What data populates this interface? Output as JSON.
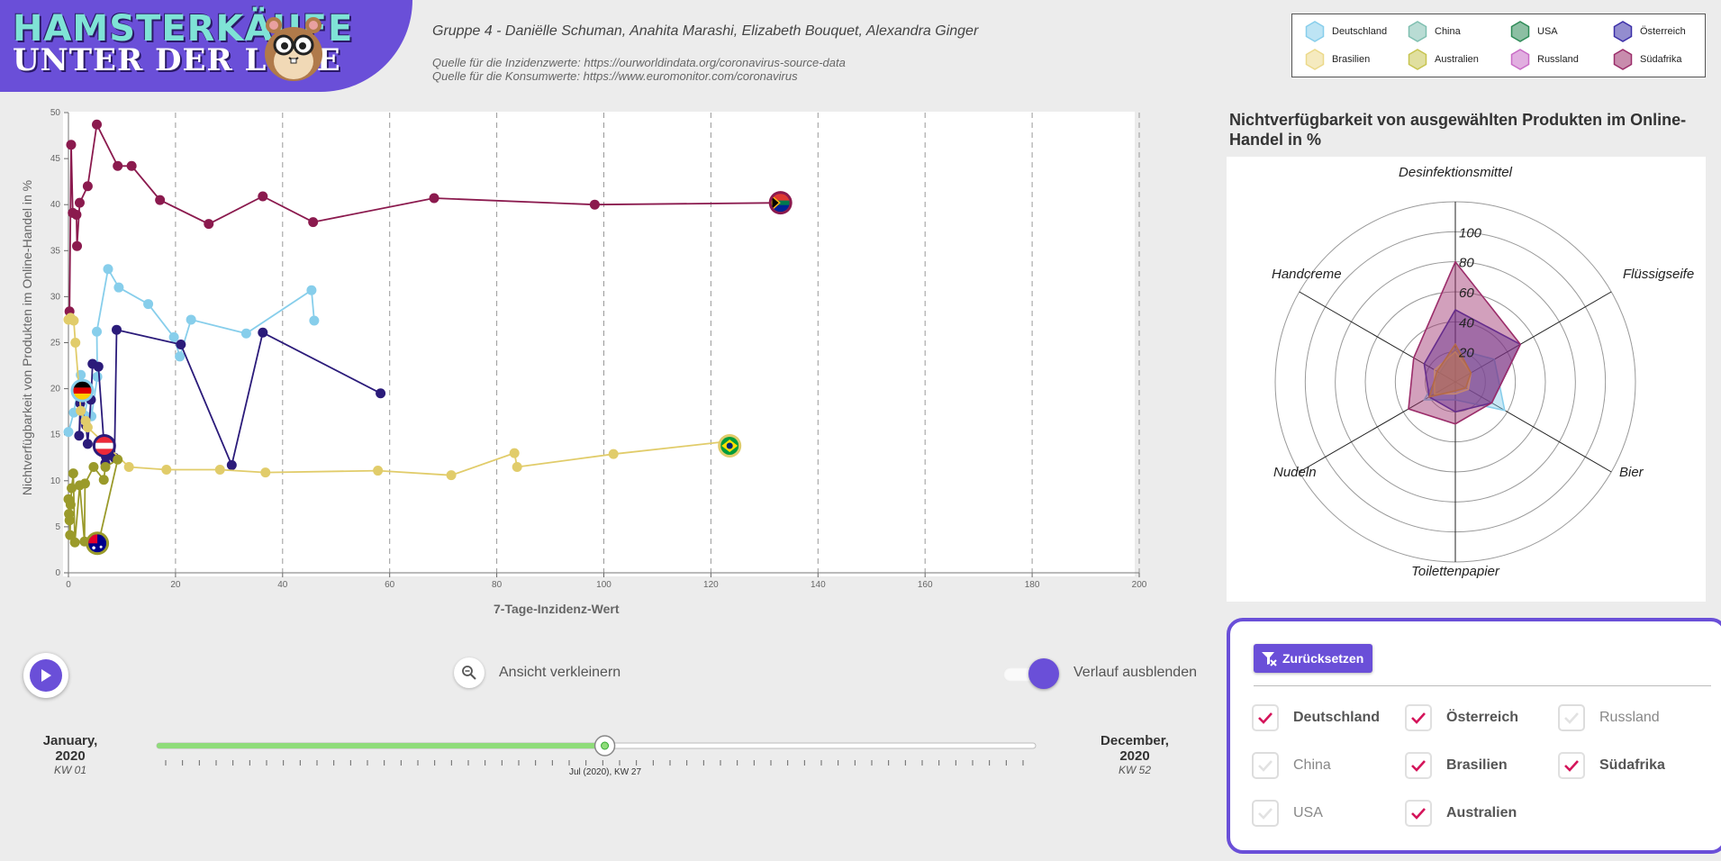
{
  "header": {
    "logo_line1": "HAMSTERKÄUFE",
    "logo_line2": "UNTER DER LUPE",
    "group": "Gruppe 4 - Daniëlle Schuman, Anahita Marashi, Elizabeth Bouquet, Alexandra Ginger",
    "source_incidence": "Quelle für die Inzidenzwerte: https://ourworldindata.org/coronavirus-source-data",
    "source_consumption": "Quelle für die Konsumwerte: https://www.euromonitor.com/coronavirus"
  },
  "legend": [
    {
      "name": "Deutschland",
      "color": "#87ceeb"
    },
    {
      "name": "China",
      "color": "#7fbfb0"
    },
    {
      "name": "USA",
      "color": "#2e8b57"
    },
    {
      "name": "Österreich",
      "color": "#3b2fa8"
    },
    {
      "name": "Brasilien",
      "color": "#ecd98a"
    },
    {
      "name": "Australien",
      "color": "#c7c450"
    },
    {
      "name": "Russland",
      "color": "#c96bc6"
    },
    {
      "name": "Südafrika",
      "color": "#9b2d6a"
    }
  ],
  "chart_data": [
    {
      "type": "scatter",
      "xlabel": "7-Tage-Inzidenz-Wert",
      "ylabel": "Nichtverfügbarkeit von Produkten im Online-Handel in %",
      "xlim": [
        0,
        200
      ],
      "ylim": [
        0,
        50
      ],
      "xticks": [
        0,
        20,
        40,
        60,
        80,
        100,
        120,
        140,
        160,
        180,
        200
      ],
      "yticks": [
        0,
        5,
        10,
        15,
        20,
        25,
        30,
        35,
        40,
        45,
        50
      ],
      "grid_x": "dashed",
      "series": [
        {
          "name": "Südafrika",
          "color": "#8b1a4e",
          "points": [
            [
              0.2,
              28.4
            ],
            [
              0.5,
              46.5
            ],
            [
              0.8,
              39.1
            ],
            [
              1.5,
              38.9
            ],
            [
              1.6,
              35.5
            ],
            [
              2.1,
              40.2
            ],
            [
              3.6,
              42.0
            ],
            [
              5.3,
              48.7
            ],
            [
              9.2,
              44.2
            ],
            [
              11.8,
              44.2
            ],
            [
              17.1,
              40.5
            ],
            [
              26.2,
              37.9
            ],
            [
              36.3,
              40.9
            ],
            [
              45.7,
              38.1
            ],
            [
              68.3,
              40.7
            ],
            [
              98.3,
              40.0
            ],
            [
              133.0,
              40.2
            ]
          ]
        },
        {
          "name": "Deutschland",
          "color": "#87ceeb",
          "points": [
            [
              0.0,
              15.3
            ],
            [
              1.0,
              17.4
            ],
            [
              2.3,
              21.5
            ],
            [
              3.0,
              17.1
            ],
            [
              3.9,
              19.8
            ],
            [
              4.3,
              17.0
            ],
            [
              5.4,
              21.3
            ],
            [
              5.3,
              26.2
            ],
            [
              7.4,
              33.0
            ],
            [
              9.4,
              31.0
            ],
            [
              14.9,
              29.2
            ],
            [
              19.7,
              25.6
            ],
            [
              20.8,
              23.5
            ],
            [
              22.9,
              27.5
            ],
            [
              33.2,
              26.0
            ],
            [
              45.4,
              30.7
            ],
            [
              45.9,
              27.4
            ]
          ]
        },
        {
          "name": "Österreich",
          "color": "#2b1b7a",
          "points": [
            [
              2.6,
              19.8
            ],
            [
              2.0,
              14.9
            ],
            [
              2.2,
              18.4
            ],
            [
              3.3,
              16.0
            ],
            [
              3.6,
              14.0
            ],
            [
              4.2,
              18.8
            ],
            [
              4.5,
              22.7
            ],
            [
              5.6,
              22.4
            ],
            [
              6.9,
              11.9
            ],
            [
              7.0,
              12.6
            ],
            [
              8.6,
              12.5
            ],
            [
              9.0,
              26.4
            ],
            [
              21.0,
              24.8
            ],
            [
              30.5,
              11.7
            ],
            [
              36.3,
              26.1
            ],
            [
              58.3,
              19.5
            ]
          ]
        },
        {
          "name": "Brasilien",
          "color": "#e1cc6a",
          "points": [
            [
              0.0,
              27.5
            ],
            [
              0.4,
              27.7
            ],
            [
              1.0,
              27.4
            ],
            [
              1.3,
              25.0
            ],
            [
              2.3,
              17.6
            ],
            [
              3.2,
              16.5
            ],
            [
              3.6,
              15.8
            ],
            [
              11.3,
              11.5
            ],
            [
              18.3,
              11.2
            ],
            [
              28.3,
              11.2
            ],
            [
              36.8,
              10.9
            ],
            [
              57.8,
              11.1
            ],
            [
              71.5,
              10.6
            ],
            [
              83.3,
              13.0
            ],
            [
              83.8,
              11.5
            ],
            [
              101.8,
              12.9
            ],
            [
              123.5,
              14.3
            ]
          ]
        },
        {
          "name": "Australien",
          "color": "#9a9a2a",
          "points": [
            [
              0.0,
              8.0
            ],
            [
              0.1,
              6.4
            ],
            [
              0.2,
              5.7
            ],
            [
              0.3,
              4.1
            ],
            [
              0.4,
              7.4
            ],
            [
              0.6,
              9.2
            ],
            [
              0.9,
              10.8
            ],
            [
              1.2,
              3.3
            ],
            [
              2.1,
              9.5
            ],
            [
              3.0,
              3.4
            ],
            [
              3.1,
              9.7
            ],
            [
              4.7,
              11.5
            ],
            [
              6.6,
              10.1
            ],
            [
              6.9,
              11.5
            ],
            [
              9.2,
              12.3
            ],
            [
              5.6,
              3.2
            ]
          ]
        }
      ],
      "markers": [
        {
          "country": "Südafrika",
          "x": 133.0,
          "y": 40.2
        },
        {
          "country": "Brasilien",
          "x": 123.5,
          "y": 13.8
        },
        {
          "country": "Deutschland",
          "x": 2.6,
          "y": 19.8
        },
        {
          "country": "Österreich",
          "x": 6.7,
          "y": 13.8
        },
        {
          "country": "Australien",
          "x": 5.4,
          "y": 3.2
        }
      ]
    },
    {
      "type": "radar",
      "title": "Nichtverfügbarkeit von ausgewählten Produkten im Online-Handel in %",
      "axes": [
        "Desinfektionsmittel",
        "Flüssigseife",
        "Bier",
        "Toilettenpapier",
        "Nudeln",
        "Handcreme"
      ],
      "rticks": [
        20,
        40,
        60,
        80,
        100
      ],
      "rmax": 120,
      "series": [
        {
          "name": "Deutschland",
          "color": "#87ceeb",
          "values": [
            22,
            30,
            38,
            12,
            24,
            12
          ]
        },
        {
          "name": "Österreich",
          "color": "#3b2fa8",
          "values": [
            48,
            50,
            28,
            20,
            20,
            24
          ]
        },
        {
          "name": "Brasilien",
          "color": "#e6cf7a",
          "values": [
            20,
            12,
            10,
            8,
            16,
            16
          ]
        },
        {
          "name": "Australien",
          "color": "#c79a2a",
          "values": [
            25,
            12,
            8,
            6,
            20,
            14
          ]
        },
        {
          "name": "Südafrika",
          "color": "#9b2d6a",
          "values": [
            80,
            50,
            28,
            28,
            36,
            32
          ]
        }
      ]
    }
  ],
  "controls": {
    "zoom_label": "Ansicht verkleinern",
    "history_label": "Verlauf ausblenden",
    "start_label": "January, 2020",
    "start_week": "KW 01",
    "end_label": "December, 2020",
    "end_week": "KW 52",
    "slider_caption": "Jul (2020), KW 27",
    "slider_value": 27,
    "slider_max": 52
  },
  "filters": {
    "reset_label": "Zurücksetzen",
    "items": [
      {
        "label": "Deutschland",
        "checked": true
      },
      {
        "label": "Österreich",
        "checked": true
      },
      {
        "label": "Russland",
        "checked": false
      },
      {
        "label": "China",
        "checked": false
      },
      {
        "label": "Brasilien",
        "checked": true
      },
      {
        "label": "Südafrika",
        "checked": true
      },
      {
        "label": "USA",
        "checked": false
      },
      {
        "label": "Australien",
        "checked": true
      }
    ]
  }
}
